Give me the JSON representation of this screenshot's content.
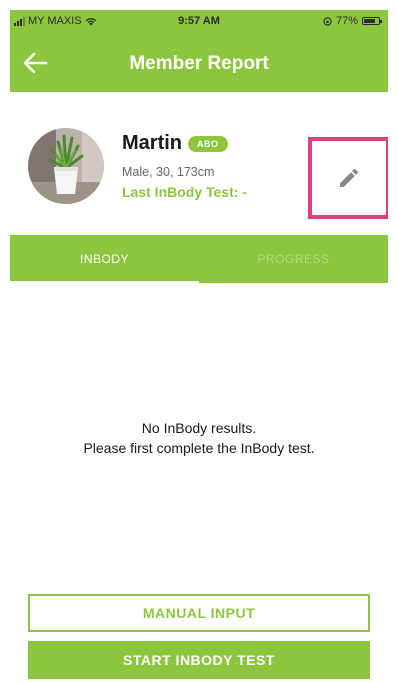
{
  "status_bar": {
    "carrier": "MY MAXIS",
    "time": "9:57 AM",
    "battery": "77%",
    "battery_level": 0.77
  },
  "nav": {
    "title": "Member Report",
    "back_icon": "arrow-left-icon"
  },
  "profile": {
    "name": "Martin",
    "badge": "ABO",
    "details": "Male, 30, 173cm",
    "last_test": "Last InBody Test: -",
    "avatar": "plant-photo",
    "edit_icon": "pencil-icon"
  },
  "tabs": [
    {
      "label": "INBODY",
      "active": true
    },
    {
      "label": "PROGRESS",
      "active": false
    }
  ],
  "empty_state": {
    "line1": "No InBody results.",
    "line2": "Please first complete the InBody test."
  },
  "buttons": {
    "manual_input": "MANUAL INPUT",
    "start_test": "START INBODY TEST"
  },
  "colors": {
    "brand_green": "#8cc63f",
    "highlight_pink": "#e43d7e"
  }
}
